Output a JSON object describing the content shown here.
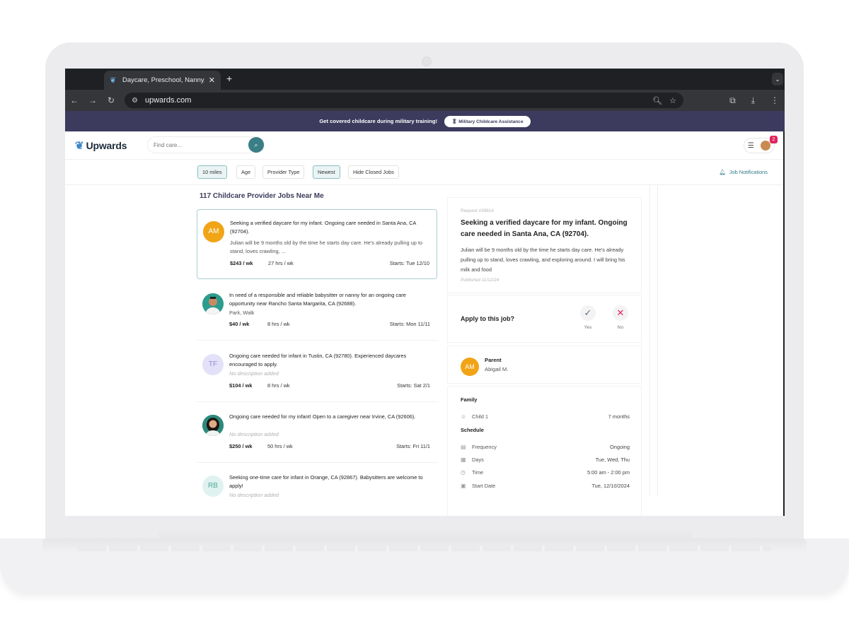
{
  "browser": {
    "tab_title": "Daycare, Preschool, Nanny, &",
    "url": "upwards.com"
  },
  "promo": {
    "text": "Get covered childcare during military training!",
    "button": "Military Childcare Assistance"
  },
  "header": {
    "logo": "Upwards",
    "search_placeholder": "Find care...",
    "badge_count": "2"
  },
  "filters": {
    "chips": [
      "10 miles",
      "Age",
      "Provider Type",
      "Newest",
      "Hide Closed Jobs"
    ],
    "job_notifications": "Job Notifications"
  },
  "listing": {
    "title": "117 Childcare Provider Jobs Near Me",
    "jobs": [
      {
        "initials": "AM",
        "title": "Seeking a verified daycare for my infant. Ongoing care needed in Santa Ana, CA (92704).",
        "description": "Julian will be 9 months old by the time he starts day care. He's already pulling up to stand, loves crawling, ...",
        "rate": "$243 / wk",
        "hours": "27 hrs / wk",
        "start": "Starts: Tue 12/10"
      },
      {
        "initials": "",
        "title": "In need of a responsible and reliable babysitter or nanny for an ongoing care opportunity near Rancho Santa Margarita, CA (92688).",
        "description": "Park, Walk",
        "rate": "$40 / wk",
        "hours": "8 hrs / wk",
        "start": "Starts: Mon 11/11"
      },
      {
        "initials": "TF",
        "title": "Ongoing care needed for infant in Tustin, CA (92780). Experienced daycares encouraged to apply.",
        "description": "No description added",
        "rate": "$104 / wk",
        "hours": "8 hrs / wk",
        "start": "Starts: Sat 2/1"
      },
      {
        "initials": "",
        "title": "Ongoing care needed for my infant! Open to a caregiver near Irvine, CA (92606).",
        "description": "No description added",
        "rate": "$250 / wk",
        "hours": "50 hrs / wk",
        "start": "Starts: Fri 11/1"
      },
      {
        "initials": "RB",
        "title": "Seeking one-time care for infant in Orange, CA (92867). Babysitters are welcome to apply!",
        "description": "No description added",
        "rate": "",
        "hours": "",
        "start": ""
      }
    ]
  },
  "detail": {
    "request_id": "Request #39814",
    "title": "Seeking a verified daycare for my infant. Ongoing care needed in Santa Ana, CA (92704).",
    "description": "Julian will be 9 months old by the time he starts day care. He's already pulling up to stand, loves crawling, and exploring around. I will bring his milk and food",
    "published": "Published 11/12/24",
    "apply_question": "Apply to this job?",
    "yes": "Yes",
    "no": "No",
    "parent_label": "Parent",
    "parent_initials": "AM",
    "parent_name": "Abigail M.",
    "family_heading": "Family",
    "child_label": "Child 1",
    "child_age": "7 months",
    "schedule_heading": "Schedule",
    "frequency_label": "Frequency",
    "frequency_value": "Ongoing",
    "days_label": "Days",
    "days_value": "Tue, Wed, Thu",
    "time_label": "Time",
    "time_value": "5:00 am - 2:00 pm",
    "start_label": "Start Date",
    "start_value": "Tue, 12/10/2024"
  },
  "colors": {
    "banner": "#3c3b5e",
    "accent": "#3a7e86",
    "avatar_orange": "#f0a416",
    "badge": "#e0245e"
  }
}
